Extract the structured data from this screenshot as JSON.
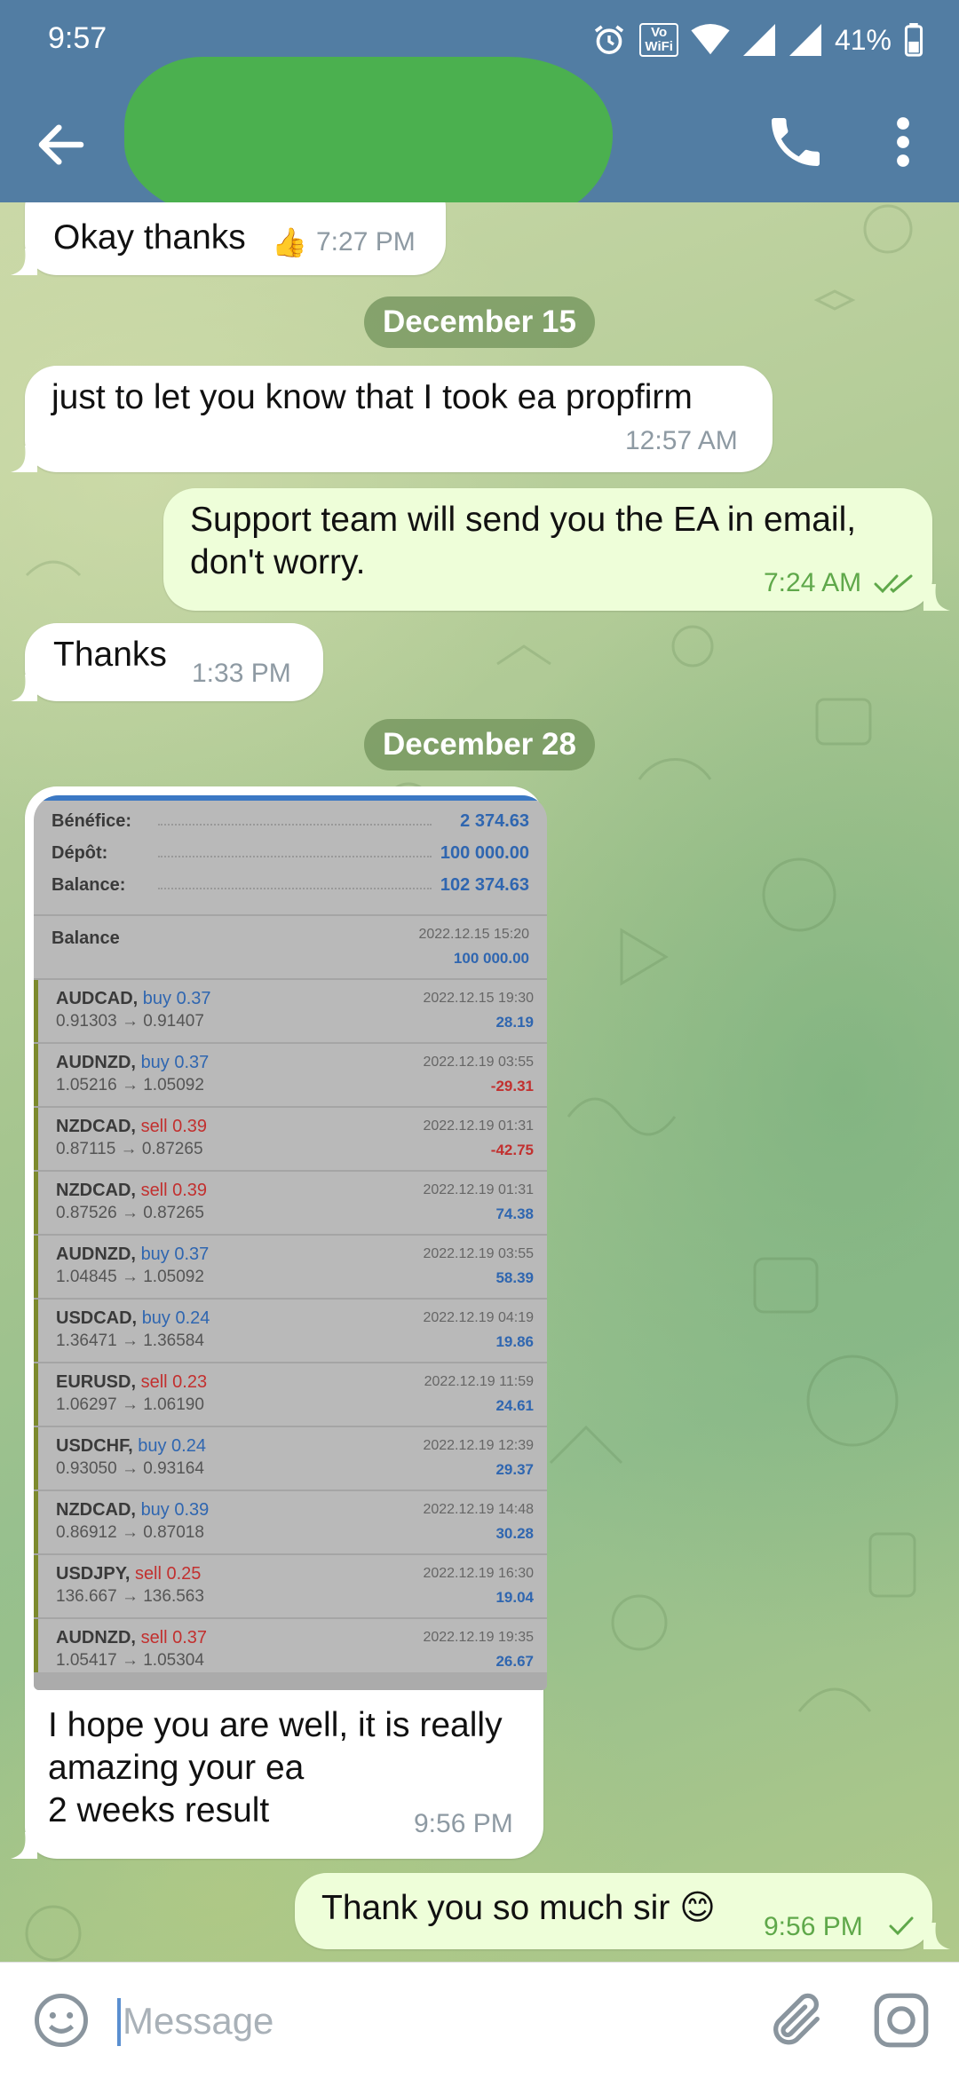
{
  "status_bar": {
    "time": "9:57",
    "volte": "Vo\u0000WiFi",
    "battery": "41%"
  },
  "app_bar": {
    "back_icon": "arrow-left-icon",
    "call_icon": "phone-icon",
    "menu_icon": "more-vert-icon"
  },
  "messages": [
    {
      "direction": "in",
      "text": "Okay thanks",
      "reaction": "👍",
      "time": "7:27 PM"
    },
    {
      "date": "December 15"
    },
    {
      "direction": "in",
      "text": "just to let you know that I took ea propfirm",
      "time": "12:57 AM"
    },
    {
      "direction": "out",
      "text_lines": [
        "Support team will send you the EA in email,",
        "don't worry."
      ],
      "time": "7:24 AM",
      "status": "double-check-icon"
    },
    {
      "direction": "in",
      "text": "Thanks",
      "time": "1:33 PM"
    },
    {
      "date": "December 28"
    },
    {
      "direction": "in",
      "caption_lines": [
        "I hope you are well, it is really",
        "amazing your ea",
        "2 weeks result"
      ],
      "time": "9:56 PM"
    },
    {
      "direction": "out",
      "text": "Thank you so much sir 😊",
      "time": "9:56 PM",
      "status": "check-icon"
    }
  ],
  "photo": {
    "summary": [
      {
        "label": "Bénéfice:",
        "value": "2 374.63"
      },
      {
        "label": "Dépôt:",
        "value": "100 000.00"
      },
      {
        "label": "Balance:",
        "value": "102 374.63"
      }
    ],
    "balance_row": {
      "label": "Balance",
      "datetime": "2022.12.15 15:20",
      "amount": "100 000.00"
    },
    "trades": [
      {
        "symbol": "AUDCAD,",
        "side": "buy 0.37",
        "prices": "0.91303 → 0.91407",
        "datetime": "2022.12.15 19:30",
        "pl": "28.19"
      },
      {
        "symbol": "AUDNZD,",
        "side": "buy 0.37",
        "prices": "1.05216 → 1.05092",
        "datetime": "2022.12.19 03:55",
        "pl": "-29.31"
      },
      {
        "symbol": "NZDCAD,",
        "side": "sell 0.39",
        "prices": "0.87115 → 0.87265",
        "datetime": "2022.12.19 01:31",
        "pl": "-42.75"
      },
      {
        "symbol": "NZDCAD,",
        "side": "sell 0.39",
        "prices": "0.87526 → 0.87265",
        "datetime": "2022.12.19 01:31",
        "pl": "74.38"
      },
      {
        "symbol": "AUDNZD,",
        "side": "buy 0.37",
        "prices": "1.04845 → 1.05092",
        "datetime": "2022.12.19 03:55",
        "pl": "58.39"
      },
      {
        "symbol": "USDCAD,",
        "side": "buy 0.24",
        "prices": "1.36471 → 1.36584",
        "datetime": "2022.12.19 04:19",
        "pl": "19.86"
      },
      {
        "symbol": "EURUSD,",
        "side": "sell 0.23",
        "prices": "1.06297 → 1.06190",
        "datetime": "2022.12.19 11:59",
        "pl": "24.61"
      },
      {
        "symbol": "USDCHF,",
        "side": "buy 0.24",
        "prices": "0.93050 → 0.93164",
        "datetime": "2022.12.19 12:39",
        "pl": "29.37"
      },
      {
        "symbol": "NZDCAD,",
        "side": "buy 0.39",
        "prices": "0.86912 → 0.87018",
        "datetime": "2022.12.19 14:48",
        "pl": "30.28"
      },
      {
        "symbol": "USDJPY,",
        "side": "sell 0.25",
        "prices": "136.667 → 136.563",
        "datetime": "2022.12.19 16:30",
        "pl": "19.04"
      },
      {
        "symbol": "AUDNZD,",
        "side": "sell 0.37",
        "prices": "1.05417 → 1.05304",
        "datetime": "2022.12.19 19:35",
        "pl": "26.67"
      }
    ]
  },
  "input": {
    "placeholder": "Message",
    "emoji_icon": "emoji-icon",
    "attach_icon": "paperclip-icon",
    "camera_icon": "camera-icon"
  }
}
